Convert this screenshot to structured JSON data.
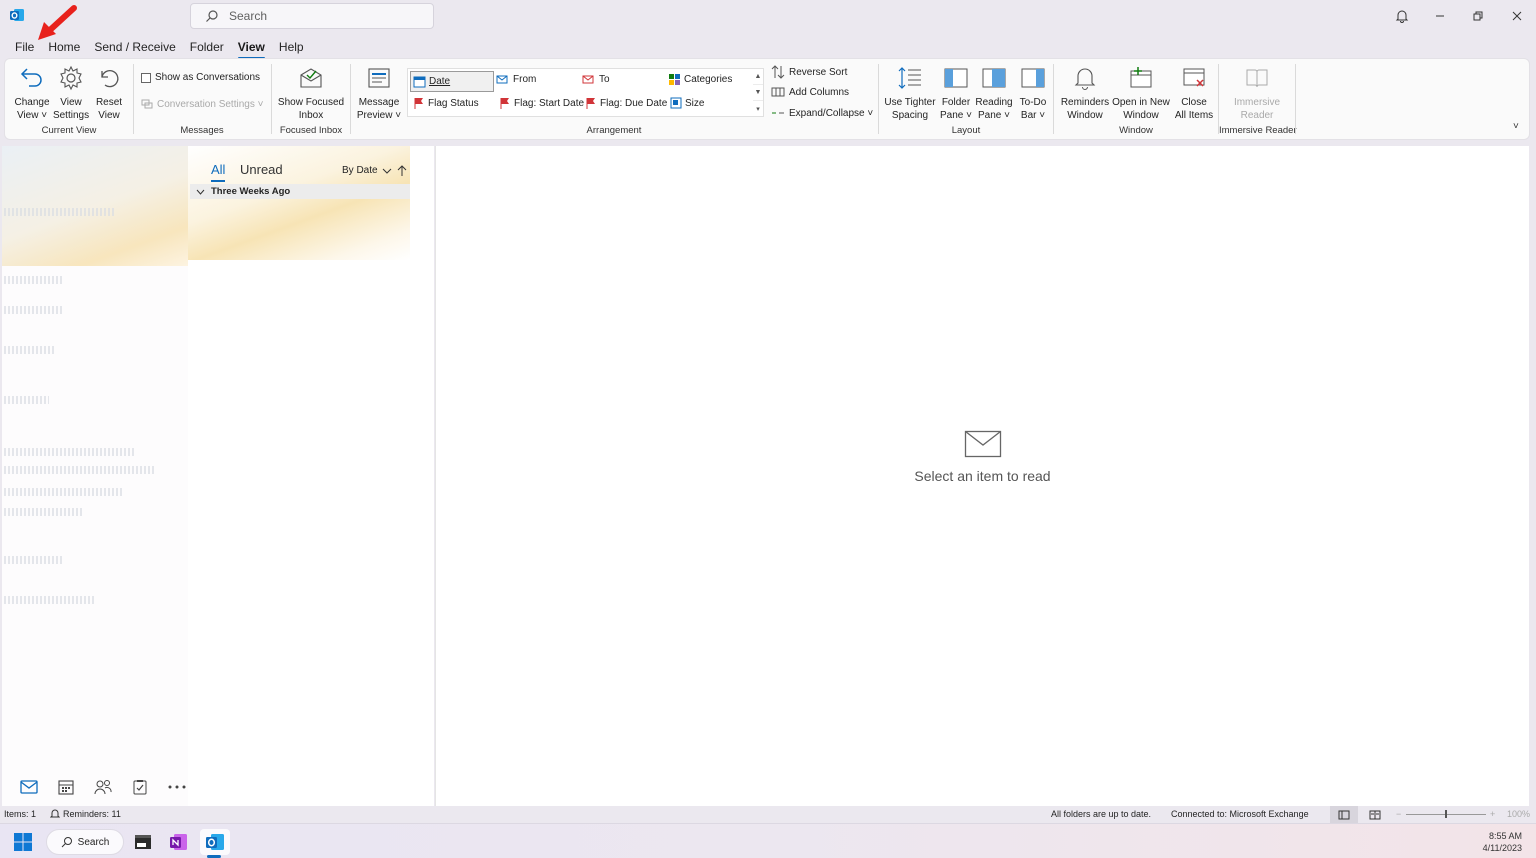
{
  "titlebar": {
    "search_placeholder": "Search"
  },
  "menu": {
    "items": [
      "File",
      "Home",
      "Send / Receive",
      "Folder",
      "View",
      "Help"
    ],
    "active": "View"
  },
  "ribbon": {
    "current_view": {
      "label": "Current View",
      "change_view": [
        "Change",
        "View"
      ],
      "view_settings": [
        "View",
        "Settings"
      ],
      "reset_view": [
        "Reset",
        "View"
      ]
    },
    "messages": {
      "label": "Messages",
      "show_conversations": "Show as Conversations",
      "conversation_settings": "Conversation Settings"
    },
    "focused_inbox": {
      "label": "Focused Inbox",
      "button": [
        "Show Focused",
        "Inbox"
      ]
    },
    "arrangement": {
      "label": "Arrangement",
      "message_preview": [
        "Message",
        "Preview"
      ],
      "items": [
        "Date",
        "From",
        "To",
        "Categories",
        "Flag Status",
        "Flag: Start Date",
        "Flag: Due Date",
        "Size"
      ],
      "selected": "Date",
      "reverse_sort": "Reverse Sort",
      "add_columns": "Add Columns",
      "expand_collapse": "Expand/Collapse"
    },
    "layout": {
      "label": "Layout",
      "tighter": [
        "Use Tighter",
        "Spacing"
      ],
      "folder_pane": [
        "Folder",
        "Pane"
      ],
      "reading_pane": [
        "Reading",
        "Pane"
      ],
      "todo_bar": [
        "To-Do",
        "Bar"
      ]
    },
    "window": {
      "label": "Window",
      "reminders": [
        "Reminders",
        "Window"
      ],
      "open_new": [
        "Open in New",
        "Window"
      ],
      "close_all": [
        "Close",
        "All Items"
      ]
    },
    "immersive": {
      "label": "Immersive Reader",
      "button": [
        "Immersive",
        "Reader"
      ]
    }
  },
  "message_list": {
    "tab_all": "All",
    "tab_unread": "Unread",
    "sort_by": "By Date",
    "group_header": "Three Weeks Ago"
  },
  "reading_pane": {
    "empty_text": "Select an item to read"
  },
  "status": {
    "items": "Items: 1",
    "reminders": "Reminders: 11",
    "sync": "All folders are up to date.",
    "connection": "Connected to: Microsoft Exchange",
    "zoom": "100%"
  },
  "taskbar": {
    "search": "Search",
    "time": "8:55 AM",
    "date": "4/11/2023"
  },
  "colors": {
    "accent": "#0f6cbd",
    "flag_red": "#d13438",
    "annotation_arrow": "#e8211c"
  },
  "icons": [
    "outlook-icon",
    "search-icon",
    "bell-icon",
    "minimize-icon",
    "restore-icon",
    "close-icon",
    "mail-icon",
    "calendar-icon",
    "people-icon",
    "tasks-icon",
    "more-icon",
    "windows-start-icon",
    "onenote-icon",
    "terminal-icon"
  ]
}
